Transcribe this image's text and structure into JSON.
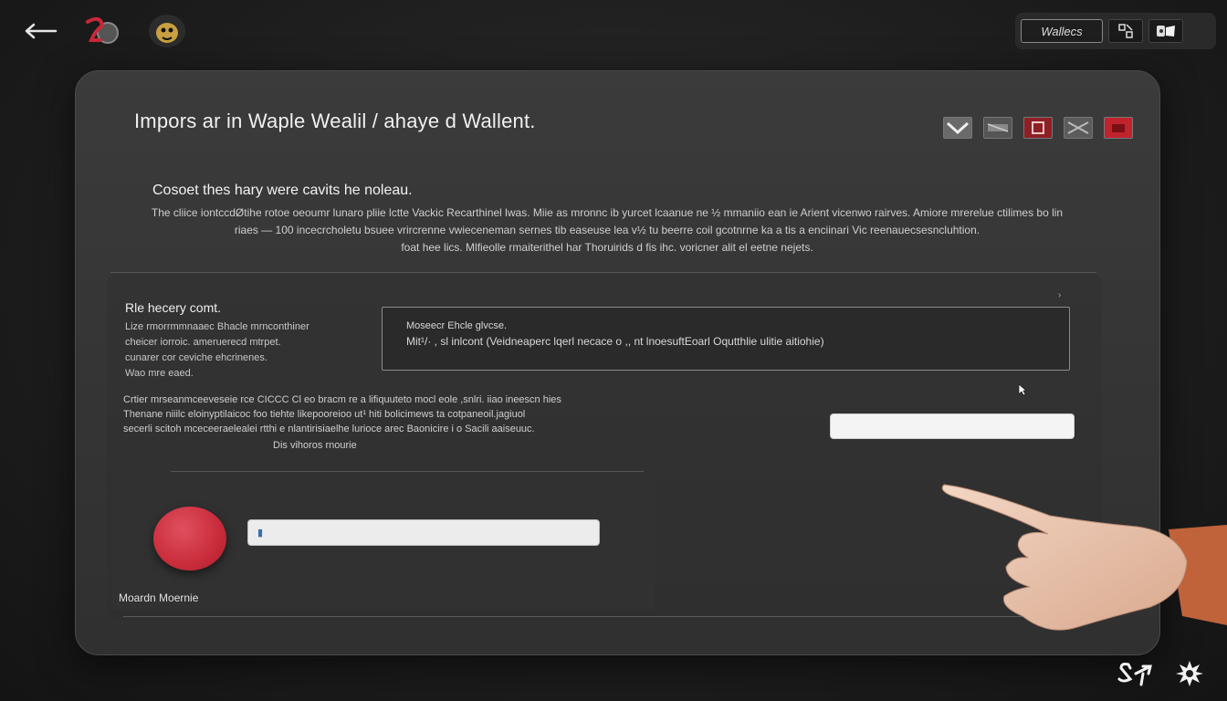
{
  "header": {
    "back_icon": "back-arrow-icon",
    "search_label": "Wallecs",
    "icons": [
      "qr-icon",
      "wallet-icon"
    ]
  },
  "panel": {
    "title": "Impors ar in Waple  Wealil / ahaye d Wallent.",
    "flags": [
      "flag-1-icon",
      "flag-2-icon",
      "flag-3-icon",
      "flag-4-icon",
      "flag-5-icon"
    ],
    "subtitle": "Cosoet thes hary were cavits he noleau.",
    "description": [
      "The cliice iontccdØtihe rotoe oeoumr lunaro pliie lctte Vackic Recarthinel lwas.    Miie as mronnc ib yurcet lcaanue ne  ½ mmaniio ean ie Arient vicenwo rairves.  Amiore mrerelue ctilimes bo lin",
      "riaes  —  100 incecrcholetu bsuee vrircrenne vwieceneman sernes tib easeuse lea v½ tu beerre coil gcotnrne ka a tis a enciinari   Vic reenauecsesncluhtion.",
      "foat hee lics. Mlfieolle rmaiterithel har Thoruirids d fis ihc. voricner alit el eetne nejets."
    ]
  },
  "form": {
    "section_label": "Rle hecery comt.",
    "section_desc": [
      "Lize rmorrmmnaaec Bhacle mrnconthiner",
      "cheicer iorroic. ameruerecd mtrpet.",
      "cunarer cor ceviche ehcrinenes.",
      "Wao mre eaed."
    ],
    "phrase_label": "Moseecr  Ehcle glvcse.",
    "phrase_value": "Mit¹/· ,  sl inlcont      (Veidneaperc lqerl necace o  ,, nt  lnoesuftEoarl       Oqutthlie ulitie aitiohie)",
    "note_text": [
      "Crtier mrseanmceeveseie rce CICCC Cl eo bracm re a lifiquuteto mocl eole ,snlri.  iiao ineescn hies",
      "Thenane niiilc eloinyptilaicoc foo  tiehte likepooreioo ut¹   hiti bolicimews ta cotpaneoil.jagiuol",
      "secerli scitoh mceceeraelealei rtthi e nlantirisiaelhe lurioce arec Baonicire i o Sacili aaiseuuc."
    ],
    "note_link": "Dis vihoros rnourie",
    "bottom_label": "Moardn Moernie"
  },
  "footer": {
    "icons": [
      "share-icon",
      "settings-icon"
    ]
  },
  "colors": {
    "accent_red": "#c92c3b",
    "panel_bg": "#383838",
    "page_bg": "#1d1d1d"
  }
}
